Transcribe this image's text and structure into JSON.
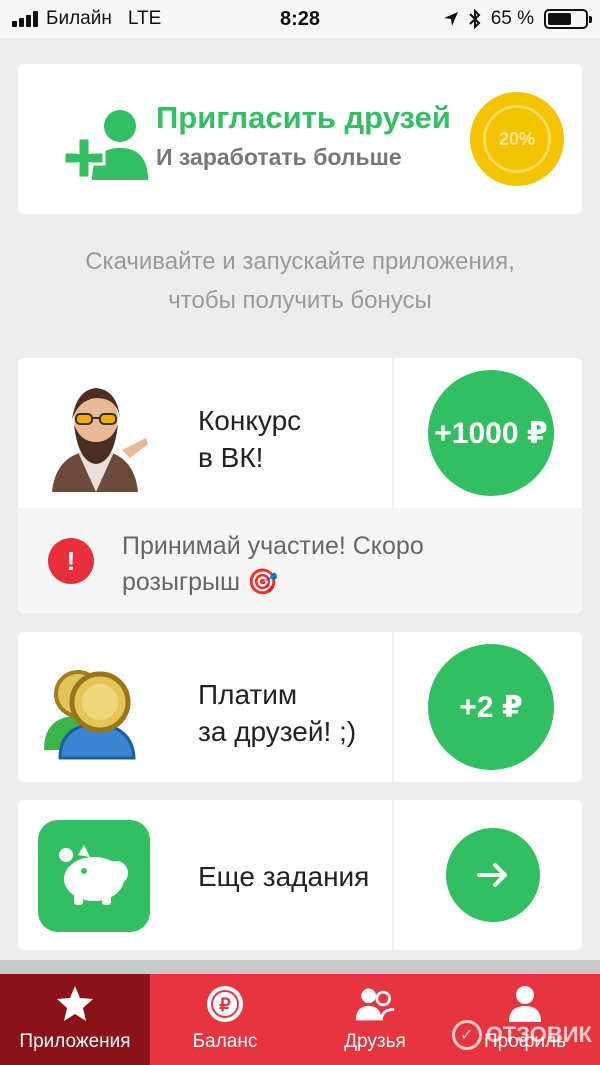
{
  "status_bar": {
    "carrier": "Билайн",
    "network": "LTE",
    "time": "8:28",
    "battery_percent": "65 %",
    "battery_level": 0.65,
    "icons": [
      "signal-icon",
      "location-arrow-icon",
      "bluetooth-icon",
      "battery-icon"
    ]
  },
  "invite": {
    "title": "Пригласить друзей",
    "subtitle": "И заработать больше",
    "badge": "20%"
  },
  "hint": {
    "line1": "Скачивайте и запускайте приложения,",
    "line2": "чтобы получить бонусы"
  },
  "tasks": [
    {
      "name_line1": "Конкурс",
      "name_line2": "в ВК!",
      "reward": "+1000 ₽",
      "notice_line1": "Принимай участие! Скоро",
      "notice_line2": "розыгрыш 🎯",
      "notice_icon": "!"
    },
    {
      "name_line1": "Платим",
      "name_line2": "за друзей! ;)",
      "reward": "+2 ₽"
    },
    {
      "name_line1": "Еще задания",
      "action_icon": "arrow-right-icon"
    }
  ],
  "tabs": [
    {
      "label": "Приложения",
      "icon": "star-icon",
      "active": true
    },
    {
      "label": "Баланс",
      "icon": "ruble-coin-icon",
      "active": false
    },
    {
      "label": "Друзья",
      "icon": "users-icon",
      "active": false
    },
    {
      "label": "Профиль",
      "icon": "user-icon",
      "active": false
    }
  ],
  "watermark": {
    "text": "ОТЗОВИК"
  },
  "colors": {
    "accent_green": "#32bf62",
    "tab_red": "#e8343e",
    "tab_active": "#8b1219",
    "coin_yellow": "#f3c300",
    "warning_red": "#e8303c"
  }
}
